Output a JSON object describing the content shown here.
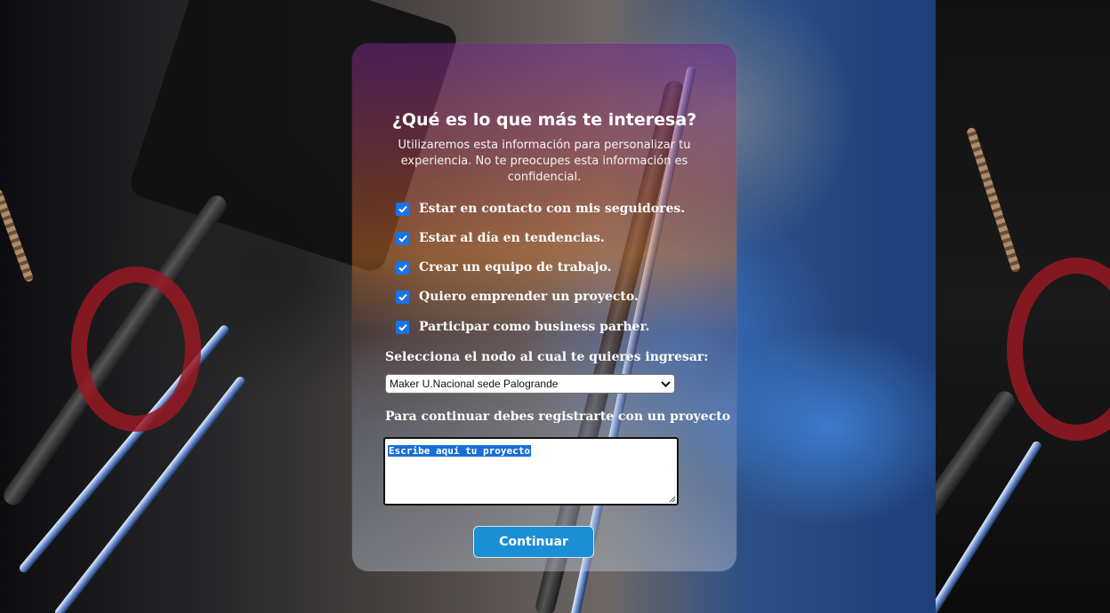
{
  "card": {
    "title": "¿Qué es lo que más te interesa?",
    "subtitle": "Utilizaremos esta información para personalizar tu experiencia. No te preocupes esta información es confidencial."
  },
  "interests": [
    {
      "label": "Estar en contacto con mis seguidores.",
      "checked": true
    },
    {
      "label": "Estar al día en tendencias.",
      "checked": true
    },
    {
      "label": "Crear un equipo de trabajo.",
      "checked": true
    },
    {
      "label": "Quiero emprender un proyecto.",
      "checked": true
    },
    {
      "label": "Participar como business parher.",
      "checked": true
    }
  ],
  "node": {
    "label": "Selecciona el nodo al cual te quieres ingresar:",
    "selected": "Maker U.Nacional sede Palogrande"
  },
  "project": {
    "label": "Para continuar debes registrarte con un proyecto",
    "value": "Escribe aquí tu proyecto"
  },
  "continue_button": "Continuar",
  "colors": {
    "checkbox": "#1a73e8",
    "button": "#1a8fd6",
    "selection": "#1a6fd6"
  }
}
